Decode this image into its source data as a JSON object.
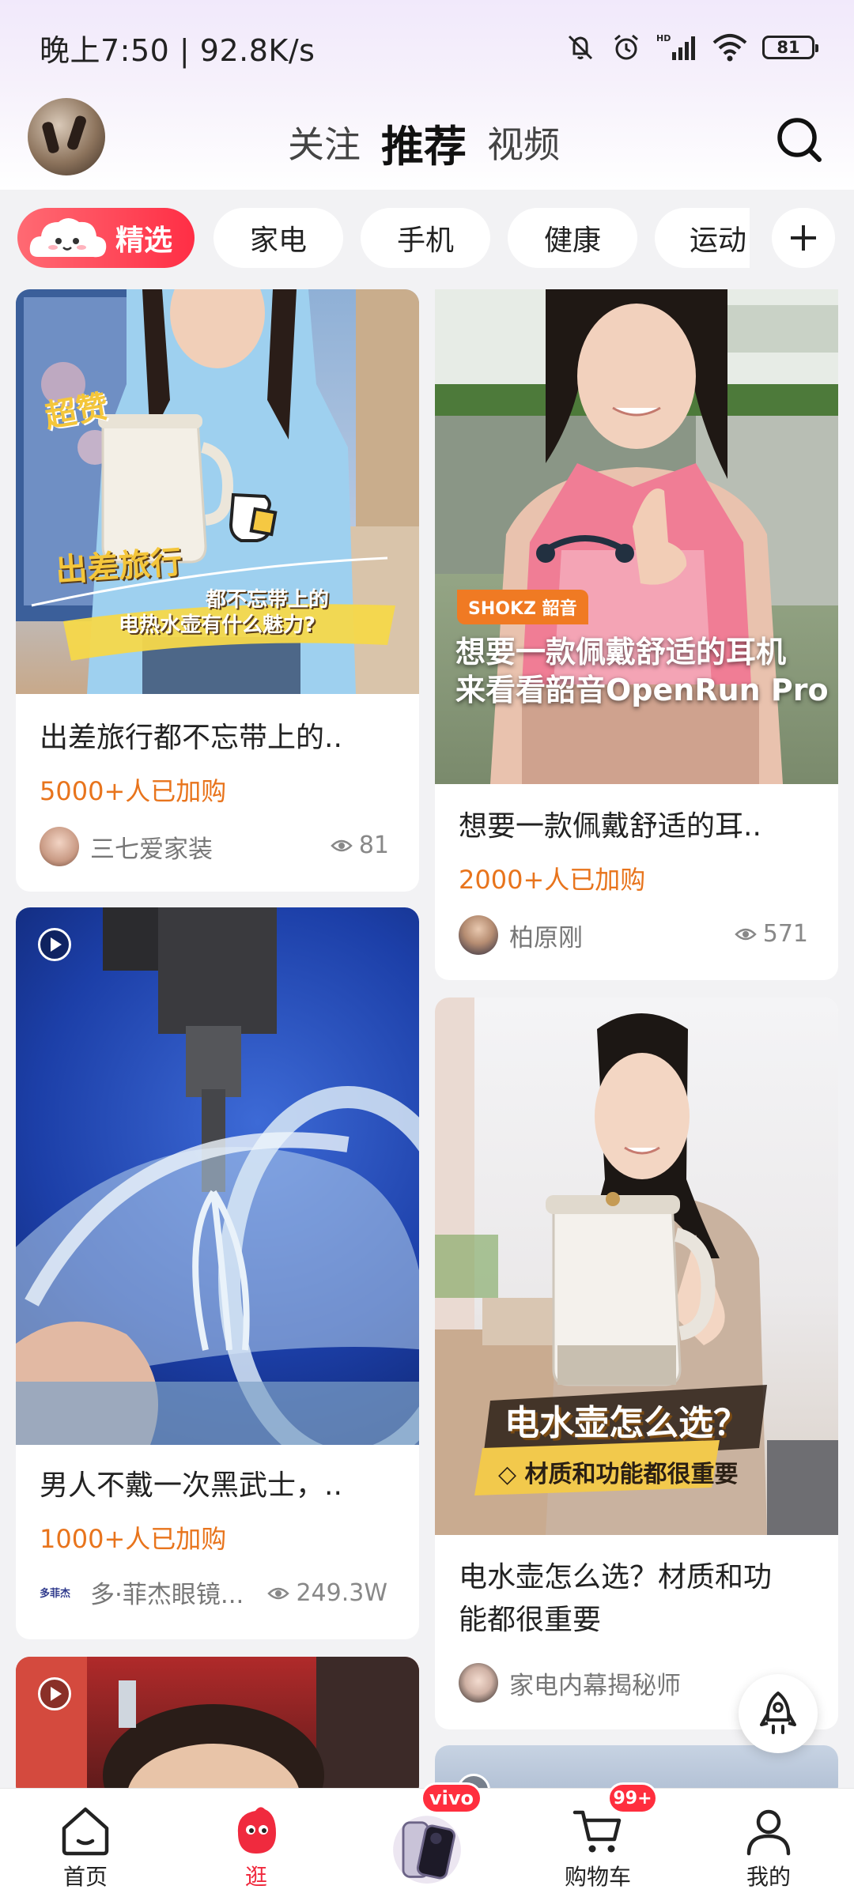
{
  "status_bar": {
    "time": "晚上7:50 | 92.8K/s",
    "battery": "81",
    "icons": [
      "mute-icon",
      "alarm-icon",
      "hd-signal-icon",
      "wifi-icon",
      "battery-icon"
    ]
  },
  "header": {
    "tabs": [
      {
        "label": "关注",
        "active": false
      },
      {
        "label": "推荐",
        "active": true
      },
      {
        "label": "视频",
        "active": false
      }
    ],
    "search_icon": "search-icon"
  },
  "categories": {
    "featured": "精选",
    "items": [
      "家电",
      "手机",
      "健康",
      "运动"
    ],
    "more_icon": "plus-icon"
  },
  "feed": {
    "left": [
      {
        "title": "出差旅行都不忘带上的..",
        "buyers": "5000+人已加购",
        "author": "三七爱家装",
        "views": "81",
        "overlay_tag": "超赞",
        "overlay_main": "出差旅行",
        "overlay_sub1": "都不忘带上的",
        "overlay_sub2": "电热水壶有什么魅力?"
      },
      {
        "title": "男人不戴一次黑武士，..",
        "buyers": "1000+人已加购",
        "author": "多·菲杰眼镜...",
        "author_logo": "多菲杰",
        "views": "249.3W"
      },
      {
        "title": ""
      }
    ],
    "right": [
      {
        "title": "想要一款佩戴舒适的耳..",
        "buyers": "2000+人已加购",
        "author": "柏原刚",
        "views": "571",
        "brand_tag": "SHOKZ 韶音",
        "overlay_line1": "想要一款佩戴舒适的耳机",
        "overlay_line2": "来看看韶音OpenRun Pro"
      },
      {
        "title_line1": "电水壶怎么选？材质和功",
        "title_line2": "能都很重要",
        "author": "家电内幕揭秘师",
        "overlay_main": "电水壶怎么选？",
        "overlay_sub": "◇ 材质和功能都很重要"
      }
    ]
  },
  "bottom_nav": {
    "items": [
      {
        "label": "首页",
        "icon": "home-icon",
        "active": false
      },
      {
        "label": "逛",
        "icon": "browse-icon",
        "active": true
      },
      {
        "label": "",
        "icon": "vivo-phone-promo",
        "badge": "vivo"
      },
      {
        "label": "购物车",
        "icon": "cart-icon",
        "badge": "99+"
      },
      {
        "label": "我的",
        "icon": "user-icon",
        "active": false
      }
    ]
  },
  "colors": {
    "accent": "#f02a3e",
    "buyers": "#e8741c",
    "background": "#f2f2f4"
  }
}
